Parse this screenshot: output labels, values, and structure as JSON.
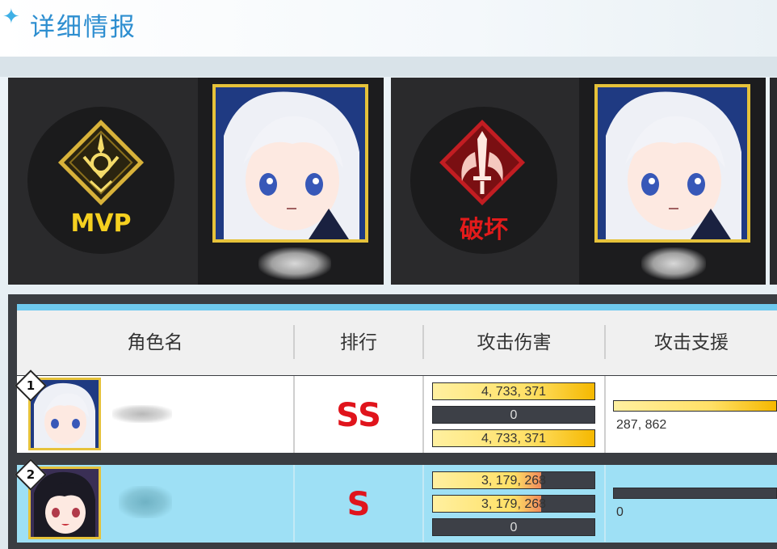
{
  "page": {
    "title": "详细情报"
  },
  "awards": [
    {
      "label": "MVP",
      "label_color": "#f5d020",
      "icon": "mvp-emblem-icon"
    },
    {
      "label": "破坏",
      "label_color": "#e21b1b",
      "icon": "sword-wings-icon"
    }
  ],
  "table": {
    "headers": {
      "name": "角色名",
      "rank": "排行",
      "attack": "攻击伤害",
      "support": "攻击支援"
    },
    "rows": [
      {
        "index": "1",
        "grade": "SS",
        "bars": [
          {
            "text": "4, 733, 371",
            "fill": 1.0
          },
          {
            "text": "0",
            "fill": 0
          },
          {
            "text": "4, 733, 371",
            "fill": 1.0
          }
        ],
        "support_value": "287, 862",
        "support_fill": 1.0
      },
      {
        "index": "2",
        "grade": "S",
        "bars": [
          {
            "text": "3, 179, 268",
            "fill": 0.67
          },
          {
            "text": "3, 179, 268",
            "fill": 0.67
          },
          {
            "text": "0",
            "fill": 0
          }
        ],
        "support_value": "0",
        "support_fill": 0
      }
    ]
  }
}
